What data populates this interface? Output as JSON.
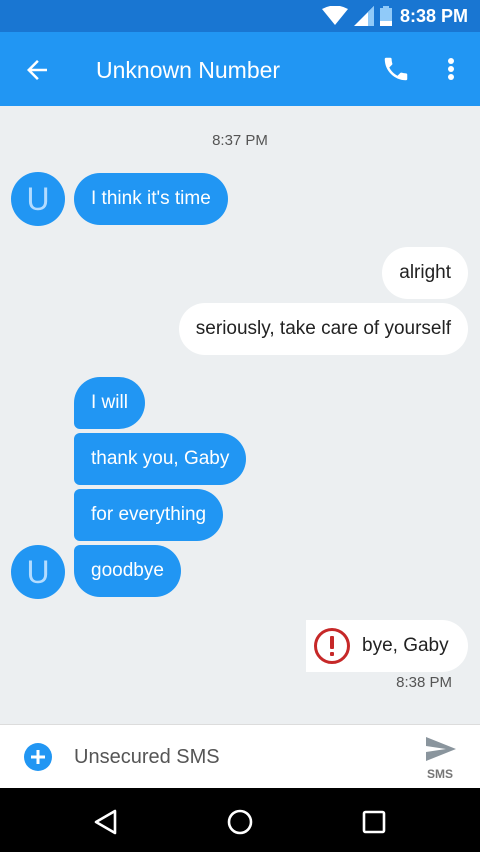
{
  "status_bar": {
    "time": "8:38 PM",
    "icons": [
      "wifi-icon",
      "signal-icon",
      "battery-icon"
    ]
  },
  "app_bar": {
    "title": "Unknown Number",
    "icons": [
      "back-arrow-icon",
      "phone-icon",
      "more-vert-icon"
    ]
  },
  "contact": {
    "avatar_letter": "U"
  },
  "thread": {
    "timestamp_top": "8:37 PM",
    "messages": [
      {
        "dir": "in",
        "text": "I think it's time"
      },
      {
        "dir": "out",
        "text": "alright"
      },
      {
        "dir": "out",
        "text": "seriously, take care of yourself"
      },
      {
        "dir": "in",
        "text": "I will"
      },
      {
        "dir": "in",
        "text": "thank you, Gaby"
      },
      {
        "dir": "in",
        "text": "for everything"
      },
      {
        "dir": "in",
        "text": "goodbye"
      },
      {
        "dir": "out",
        "text": "bye, Gaby",
        "status": "failed"
      }
    ],
    "timestamp_bottom": "8:38 PM"
  },
  "compose": {
    "placeholder": "Unsecured SMS",
    "send_label": "SMS"
  },
  "nav_bar": {
    "icons": [
      "back-triangle-icon",
      "home-circle-icon",
      "recents-square-icon"
    ]
  },
  "colors": {
    "primary": "#2196f3",
    "primary_dark": "#1976d2",
    "incoming_bubble": "#2196f3",
    "outgoing_bubble": "#ffffff",
    "error": "#c62828",
    "background": "#eceff1"
  }
}
